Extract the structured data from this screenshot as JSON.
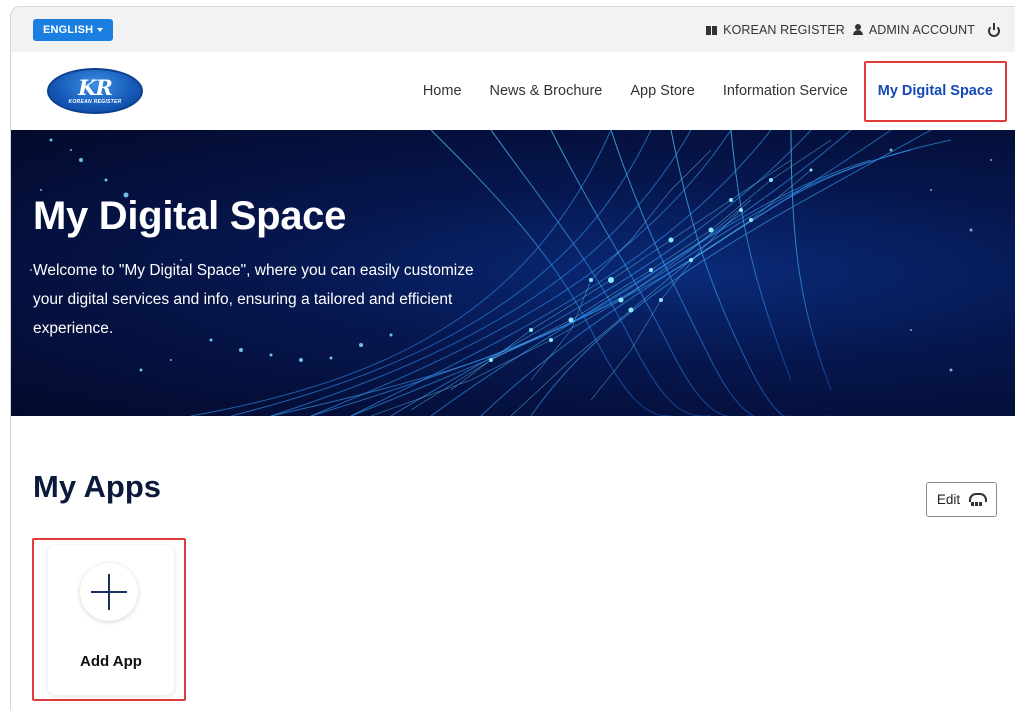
{
  "topbar": {
    "language": "ENGLISH",
    "org": "KOREAN REGISTER",
    "account": "ADMIN ACCOUNT"
  },
  "logo": {
    "mark": "KR",
    "subtitle": "KOREAN REGISTER"
  },
  "nav": {
    "items": [
      {
        "label": "Home"
      },
      {
        "label": "News & Brochure"
      },
      {
        "label": "App Store"
      },
      {
        "label": "Information Service"
      },
      {
        "label": "My Digital Space",
        "active": true
      }
    ]
  },
  "hero": {
    "title": "My Digital Space",
    "description": "Welcome to \"My Digital Space\", where you can easily customize your digital services and info, ensuring a tailored and efficient experience."
  },
  "apps": {
    "title": "My Apps",
    "edit_label": "Edit",
    "add_app_label": "Add App"
  },
  "colors": {
    "accent_blue": "#1a7fe0",
    "active_nav": "#1349b8",
    "highlight_red": "#e03a3a",
    "hero_dark": "#030a2c"
  },
  "icons": [
    "building-icon",
    "user-icon",
    "power-icon",
    "edit-layout-icon",
    "plus-icon",
    "caret-down-icon"
  ]
}
